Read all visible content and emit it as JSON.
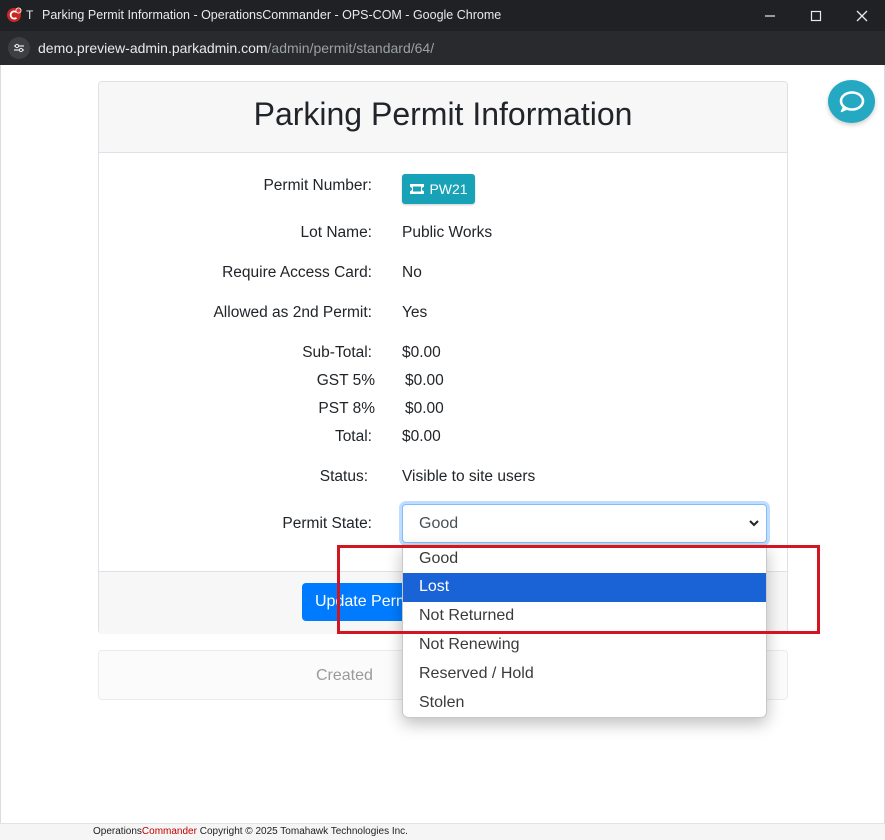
{
  "browser": {
    "window_title": "Parking Permit Information - OperationsCommander - OPS-COM - Google Chrome",
    "tab_letter": "T",
    "url_host": "demo.preview-admin.parkadmin.com",
    "url_path": "/admin/permit/standard/64/"
  },
  "card": {
    "title": "Parking Permit Information",
    "fields": {
      "permit_number_label": "Permit Number:",
      "permit_number_value": "PW21",
      "lot_name_label": "Lot Name:",
      "lot_name_value": "Public Works",
      "access_card_label": "Require Access Card:",
      "access_card_value": "No",
      "second_permit_label": "Allowed as 2nd Permit:",
      "second_permit_value": "Yes",
      "subtotal_label": "Sub-Total:",
      "subtotal_value": "$0.00",
      "gst_label": "GST 5%",
      "gst_value": "$0.00",
      "pst_label": "PST 8%",
      "pst_value": "$0.00",
      "total_label": "Total:",
      "total_value": "$0.00",
      "status_label": "Status:",
      "status_value": "Visible to site users",
      "permit_state_label": "Permit State:",
      "permit_state_value": "Good"
    },
    "update_button": "Update Permit"
  },
  "meta": {
    "created_label": "Created"
  },
  "dropdown": {
    "options": [
      "Good",
      "Lost",
      "Not Returned",
      "Not Renewing",
      "Reserved / Hold",
      "Stolen"
    ],
    "highlighted": "Lost"
  },
  "footer": {
    "brand_a": "Operations",
    "brand_b": "Commander",
    "copyright": " Copyright © 2025 Tomahawk Technologies Inc."
  },
  "colors": {
    "primary": "#007bff",
    "info": "#17a2b8",
    "highlight_box": "#d01620",
    "selected_option": "#1a63d6"
  }
}
